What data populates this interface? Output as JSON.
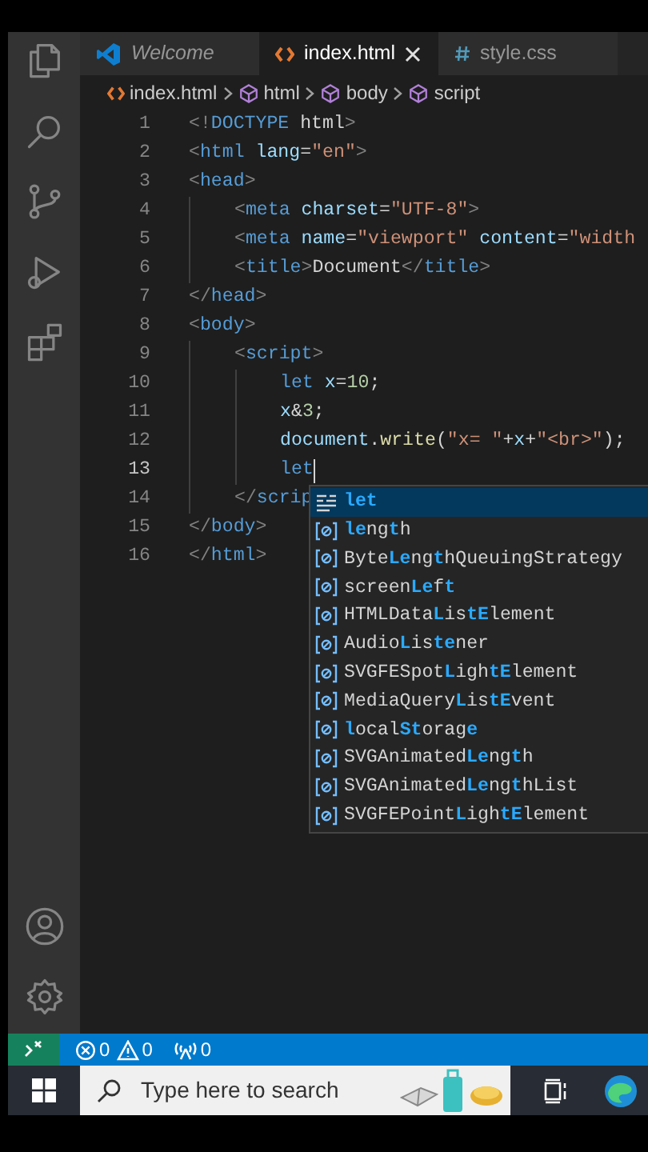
{
  "tabs": [
    {
      "label": "Welcome",
      "kind": "welcome",
      "selected": false,
      "closable": false
    },
    {
      "label": "index.html",
      "kind": "html",
      "selected": true,
      "closable": true
    },
    {
      "label": "style.css",
      "kind": "css",
      "selected": false,
      "closable": false
    }
  ],
  "breadcrumb": [
    {
      "label": "index.html",
      "kind": "file"
    },
    {
      "label": "html",
      "kind": "element"
    },
    {
      "label": "body",
      "kind": "element"
    },
    {
      "label": "script",
      "kind": "element"
    }
  ],
  "code_lines": [
    {
      "number": "1",
      "current": false,
      "tokens": [
        {
          "text": "<!",
          "kind": "punct"
        },
        {
          "text": "DOCTYPE",
          "kind": "tag"
        },
        {
          "text": " html",
          "kind": "text"
        },
        {
          "text": ">",
          "kind": "punct"
        }
      ]
    },
    {
      "number": "2",
      "current": false,
      "tokens": [
        {
          "text": "<",
          "kind": "punct"
        },
        {
          "text": "html",
          "kind": "tag"
        },
        {
          "text": " lang",
          "kind": "attr"
        },
        {
          "text": "=",
          "kind": "text"
        },
        {
          "text": "\"en\"",
          "kind": "string"
        },
        {
          "text": ">",
          "kind": "punct"
        }
      ]
    },
    {
      "number": "3",
      "current": false,
      "tokens": [
        {
          "text": "<",
          "kind": "punct"
        },
        {
          "text": "head",
          "kind": "tag"
        },
        {
          "text": ">",
          "kind": "punct"
        }
      ],
      "children": [
        {
          "number": "4",
          "current": false,
          "tokens": [
            {
              "text": "<",
              "kind": "punct"
            },
            {
              "text": "meta",
              "kind": "tag"
            },
            {
              "text": " charset",
              "kind": "attr"
            },
            {
              "text": "=",
              "kind": "text"
            },
            {
              "text": "\"UTF-8\"",
              "kind": "string"
            },
            {
              "text": ">",
              "kind": "punct"
            }
          ]
        },
        {
          "number": "5",
          "current": false,
          "tokens": [
            {
              "text": "<",
              "kind": "punct"
            },
            {
              "text": "meta",
              "kind": "tag"
            },
            {
              "text": " name",
              "kind": "attr"
            },
            {
              "text": "=",
              "kind": "text"
            },
            {
              "text": "\"viewport\"",
              "kind": "string"
            },
            {
              "text": " content",
              "kind": "attr"
            },
            {
              "text": "=",
              "kind": "text"
            },
            {
              "text": "\"width",
              "kind": "string"
            }
          ]
        },
        {
          "number": "6",
          "current": false,
          "tokens": [
            {
              "text": "<",
              "kind": "punct"
            },
            {
              "text": "title",
              "kind": "tag"
            },
            {
              "text": ">",
              "kind": "punct"
            },
            {
              "text": "Document",
              "kind": "text"
            },
            {
              "text": "</",
              "kind": "punct"
            },
            {
              "text": "title",
              "kind": "tag"
            },
            {
              "text": ">",
              "kind": "punct"
            }
          ]
        }
      ]
    },
    {
      "number": "7",
      "current": false,
      "tokens": [
        {
          "text": "</",
          "kind": "punct"
        },
        {
          "text": "head",
          "kind": "tag"
        },
        {
          "text": ">",
          "kind": "punct"
        }
      ]
    },
    {
      "number": "8",
      "current": false,
      "tokens": [
        {
          "text": "<",
          "kind": "punct"
        },
        {
          "text": "body",
          "kind": "tag"
        },
        {
          "text": ">",
          "kind": "punct"
        }
      ],
      "children": [
        {
          "number": "9",
          "current": false,
          "tokens": [
            {
              "text": "<",
              "kind": "punct"
            },
            {
              "text": "script",
              "kind": "tag"
            },
            {
              "text": ">",
              "kind": "punct"
            }
          ],
          "children": [
            {
              "number": "10",
              "current": false,
              "tokens": [
                {
                  "text": "let",
                  "kind": "keyword"
                },
                {
                  "text": " x",
                  "kind": "variable"
                },
                {
                  "text": "=",
                  "kind": "text"
                },
                {
                  "text": "10",
                  "kind": "number"
                },
                {
                  "text": ";",
                  "kind": "text"
                }
              ]
            },
            {
              "number": "11",
              "current": false,
              "tokens": [
                {
                  "text": "x",
                  "kind": "variable"
                },
                {
                  "text": "&",
                  "kind": "text"
                },
                {
                  "text": "3",
                  "kind": "number"
                },
                {
                  "text": ";",
                  "kind": "text"
                }
              ]
            },
            {
              "number": "12",
              "current": false,
              "tokens": [
                {
                  "text": "document",
                  "kind": "variable"
                },
                {
                  "text": ".",
                  "kind": "text"
                },
                {
                  "text": "write",
                  "kind": "function"
                },
                {
                  "text": "(",
                  "kind": "text"
                },
                {
                  "text": "\"x= \"",
                  "kind": "string"
                },
                {
                  "text": "+",
                  "kind": "text"
                },
                {
                  "text": "x",
                  "kind": "variable"
                },
                {
                  "text": "+",
                  "kind": "text"
                },
                {
                  "text": "\"<br>\"",
                  "kind": "string"
                },
                {
                  "text": ");",
                  "kind": "text"
                }
              ]
            },
            {
              "number": "13",
              "current": true,
              "tokens": [
                {
                  "text": "let",
                  "kind": "keyword"
                }
              ]
            }
          ]
        },
        {
          "number": "14",
          "current": false,
          "tokens": [
            {
              "text": "</",
              "kind": "punct"
            },
            {
              "text": "scrip",
              "kind": "tag"
            }
          ]
        }
      ]
    },
    {
      "number": "15",
      "current": false,
      "tokens": [
        {
          "text": "</",
          "kind": "punct"
        },
        {
          "text": "body",
          "kind": "tag"
        },
        {
          "text": ">",
          "kind": "punct"
        }
      ]
    },
    {
      "number": "16",
      "current": false,
      "tokens": [
        {
          "text": "</",
          "kind": "punct"
        },
        {
          "text": "html",
          "kind": "tag"
        },
        {
          "text": ">",
          "kind": "punct"
        }
      ]
    }
  ],
  "suggestions": [
    {
      "kind": "keyword",
      "selected": true,
      "parts": [
        {
          "text": "let",
          "match": true
        }
      ]
    },
    {
      "kind": "variable",
      "selected": false,
      "parts": [
        {
          "text": "le",
          "match": true
        },
        {
          "text": "ng",
          "match": false
        },
        {
          "text": "t",
          "match": true
        },
        {
          "text": "h",
          "match": false
        }
      ]
    },
    {
      "kind": "variable",
      "selected": false,
      "parts": [
        {
          "text": "Byte",
          "match": false
        },
        {
          "text": "Le",
          "match": true
        },
        {
          "text": "ng",
          "match": false
        },
        {
          "text": "t",
          "match": true
        },
        {
          "text": "hQueuingStrategy",
          "match": false
        }
      ]
    },
    {
      "kind": "variable",
      "selected": false,
      "parts": [
        {
          "text": "screen",
          "match": false
        },
        {
          "text": "Le",
          "match": true
        },
        {
          "text": "f",
          "match": false
        },
        {
          "text": "t",
          "match": true
        }
      ]
    },
    {
      "kind": "variable",
      "selected": false,
      "parts": [
        {
          "text": "HTMLData",
          "match": false
        },
        {
          "text": "L",
          "match": true
        },
        {
          "text": "is",
          "match": false
        },
        {
          "text": "tE",
          "match": true
        },
        {
          "text": "lement",
          "match": false
        }
      ]
    },
    {
      "kind": "variable",
      "selected": false,
      "parts": [
        {
          "text": "Audio",
          "match": false
        },
        {
          "text": "L",
          "match": true
        },
        {
          "text": "is",
          "match": false
        },
        {
          "text": "te",
          "match": true
        },
        {
          "text": "ner",
          "match": false
        }
      ]
    },
    {
      "kind": "variable",
      "selected": false,
      "parts": [
        {
          "text": "SVGFESpot",
          "match": false
        },
        {
          "text": "L",
          "match": true
        },
        {
          "text": "igh",
          "match": false
        },
        {
          "text": "tE",
          "match": true
        },
        {
          "text": "lement",
          "match": false
        }
      ]
    },
    {
      "kind": "variable",
      "selected": false,
      "parts": [
        {
          "text": "MediaQuery",
          "match": false
        },
        {
          "text": "L",
          "match": true
        },
        {
          "text": "is",
          "match": false
        },
        {
          "text": "tE",
          "match": true
        },
        {
          "text": "vent",
          "match": false
        }
      ]
    },
    {
      "kind": "variable",
      "selected": false,
      "parts": [
        {
          "text": "l",
          "match": true
        },
        {
          "text": "ocal",
          "match": false
        },
        {
          "text": "St",
          "match": true
        },
        {
          "text": "orag",
          "match": false
        },
        {
          "text": "e",
          "match": true
        }
      ]
    },
    {
      "kind": "variable",
      "selected": false,
      "parts": [
        {
          "text": "SVGAnimated",
          "match": false
        },
        {
          "text": "Le",
          "match": true
        },
        {
          "text": "ng",
          "match": false
        },
        {
          "text": "t",
          "match": true
        },
        {
          "text": "h",
          "match": false
        }
      ]
    },
    {
      "kind": "variable",
      "selected": false,
      "parts": [
        {
          "text": "SVGAnimated",
          "match": false
        },
        {
          "text": "Le",
          "match": true
        },
        {
          "text": "ng",
          "match": false
        },
        {
          "text": "t",
          "match": true
        },
        {
          "text": "hList",
          "match": false
        }
      ]
    },
    {
      "kind": "variable",
      "selected": false,
      "parts": [
        {
          "text": "SVGFEPoint",
          "match": false
        },
        {
          "text": "L",
          "match": true
        },
        {
          "text": "igh",
          "match": false
        },
        {
          "text": "tE",
          "match": true
        },
        {
          "text": "lement",
          "match": false
        }
      ]
    }
  ],
  "status_bar": {
    "errors": "0",
    "warnings": "0",
    "ports": "0"
  },
  "taskbar": {
    "search_placeholder": "Type here to search"
  }
}
